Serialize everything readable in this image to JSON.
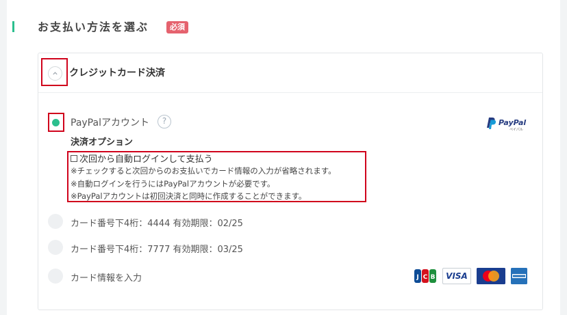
{
  "section": {
    "title": "お支払い方法を選ぶ",
    "required_badge": "必須"
  },
  "card_section": {
    "title": "クレジットカード決済",
    "toggle_icon": "chevron-up-icon"
  },
  "paypal": {
    "label": "PayPalアカウント",
    "help": "?",
    "logo_text": "PayPal",
    "logo_subtext": "ペイパル"
  },
  "payment_options": {
    "title": "決済オプション",
    "auto_login_label": "次回から自動ログインして支払う",
    "notes": [
      "※チェックすると次回からのお支払いでカード情報の入力が省略されます。",
      "※自動ログインを行うにはPayPalアカウントが必要です。",
      "※PayPalアカウントは初回決済と同時に作成することができます。"
    ]
  },
  "saved_cards": [
    {
      "label": "カード番号下4桁：4444 有効期限：02/25"
    },
    {
      "label": "カード番号下4桁：7777 有効期限：03/25"
    }
  ],
  "new_card": {
    "label": "カード情報を入力",
    "brands": [
      {
        "name": "JCB",
        "icon": "jcb-logo-icon"
      },
      {
        "name": "VISA",
        "icon": "visa-logo-icon"
      },
      {
        "name": "MasterCard",
        "icon": "mastercard-logo-icon"
      },
      {
        "name": "AMEX",
        "icon": "amex-logo-icon"
      }
    ]
  },
  "colors": {
    "accent": "#2bbf8e",
    "required": "#e5626e",
    "highlight": "#d0021b"
  }
}
